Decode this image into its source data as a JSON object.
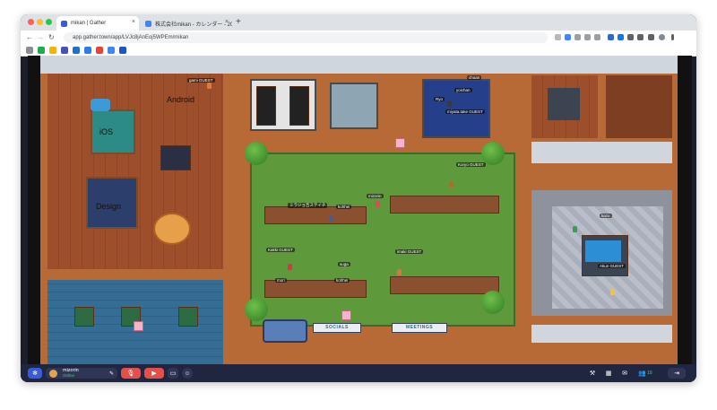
{
  "browser": {
    "tabs": [
      {
        "title": "mikan | Gather",
        "active": true,
        "favicon_color": "#3a5bd9"
      },
      {
        "title": "株式会社mikan - カレンダー - 20",
        "active": false,
        "favicon_color": "#4285f4"
      }
    ],
    "new_tab_label": "+",
    "close_glyph": "×",
    "back_glyph": "←",
    "forward_glyph": "→",
    "reload_glyph": "↻",
    "url": "app.gather.town/app/LVJc8jAnEoj5WPEm/mikan"
  },
  "map": {
    "rooms": {
      "android": "Android",
      "ios": "iOS",
      "design": "Design"
    },
    "signs": {
      "socials": "SOCIALS",
      "meetings": "MEETINGS"
    },
    "player_tags": [
      {
        "id": "gami",
        "text": "gami",
        "guest": "GUEST"
      },
      {
        "id": "yoichan",
        "text": "yoichan",
        "guest": ""
      },
      {
        "id": "ryo",
        "text": "Ryo",
        "guest": ""
      },
      {
        "id": "chuan",
        "text": "chuan",
        "guest": ""
      },
      {
        "id": "miyata",
        "text": "miyata.take",
        "guest": "GUEST"
      },
      {
        "id": "mizorin",
        "text": "mizorin",
        "guest": ""
      },
      {
        "id": "koryo",
        "text": "Koryo",
        "guest": "GUEST"
      },
      {
        "id": "mijikan",
        "text": "ミラジョ吉ステイチ",
        "guest": ""
      },
      {
        "id": "kohhei",
        "text": "kohhei",
        "guest": ""
      },
      {
        "id": "kakki",
        "text": "Kakki",
        "guest": "GUEST"
      },
      {
        "id": "suga",
        "text": "suga",
        "guest": ""
      },
      {
        "id": "imaki",
        "text": "imaki",
        "guest": "GUEST"
      },
      {
        "id": "mori",
        "text": "mori",
        "guest": ""
      },
      {
        "id": "kohhei2",
        "text": "kohhei",
        "guest": ""
      },
      {
        "id": "kazu",
        "text": "kazu",
        "guest": ""
      },
      {
        "id": "akun",
        "text": "Akun",
        "guest": "GUEST"
      }
    ]
  },
  "bottom_bar": {
    "user_name": "mizorin",
    "user_status": "Online",
    "participants_count": "18",
    "icons": {
      "gather": "gather-logo-icon",
      "mic": "mic-muted-icon",
      "camera": "camera-muted-icon",
      "screen": "screen-share-icon",
      "emoji": "emoji-icon",
      "build": "hammer-icon",
      "calendar": "calendar-icon",
      "chat": "chat-icon",
      "people": "people-icon",
      "leave": "leave-icon"
    }
  },
  "colors": {
    "accent": "#3a5bd9",
    "muted_red": "#e2504c",
    "bar_bg": "#202540",
    "online": "#3ecf72"
  }
}
